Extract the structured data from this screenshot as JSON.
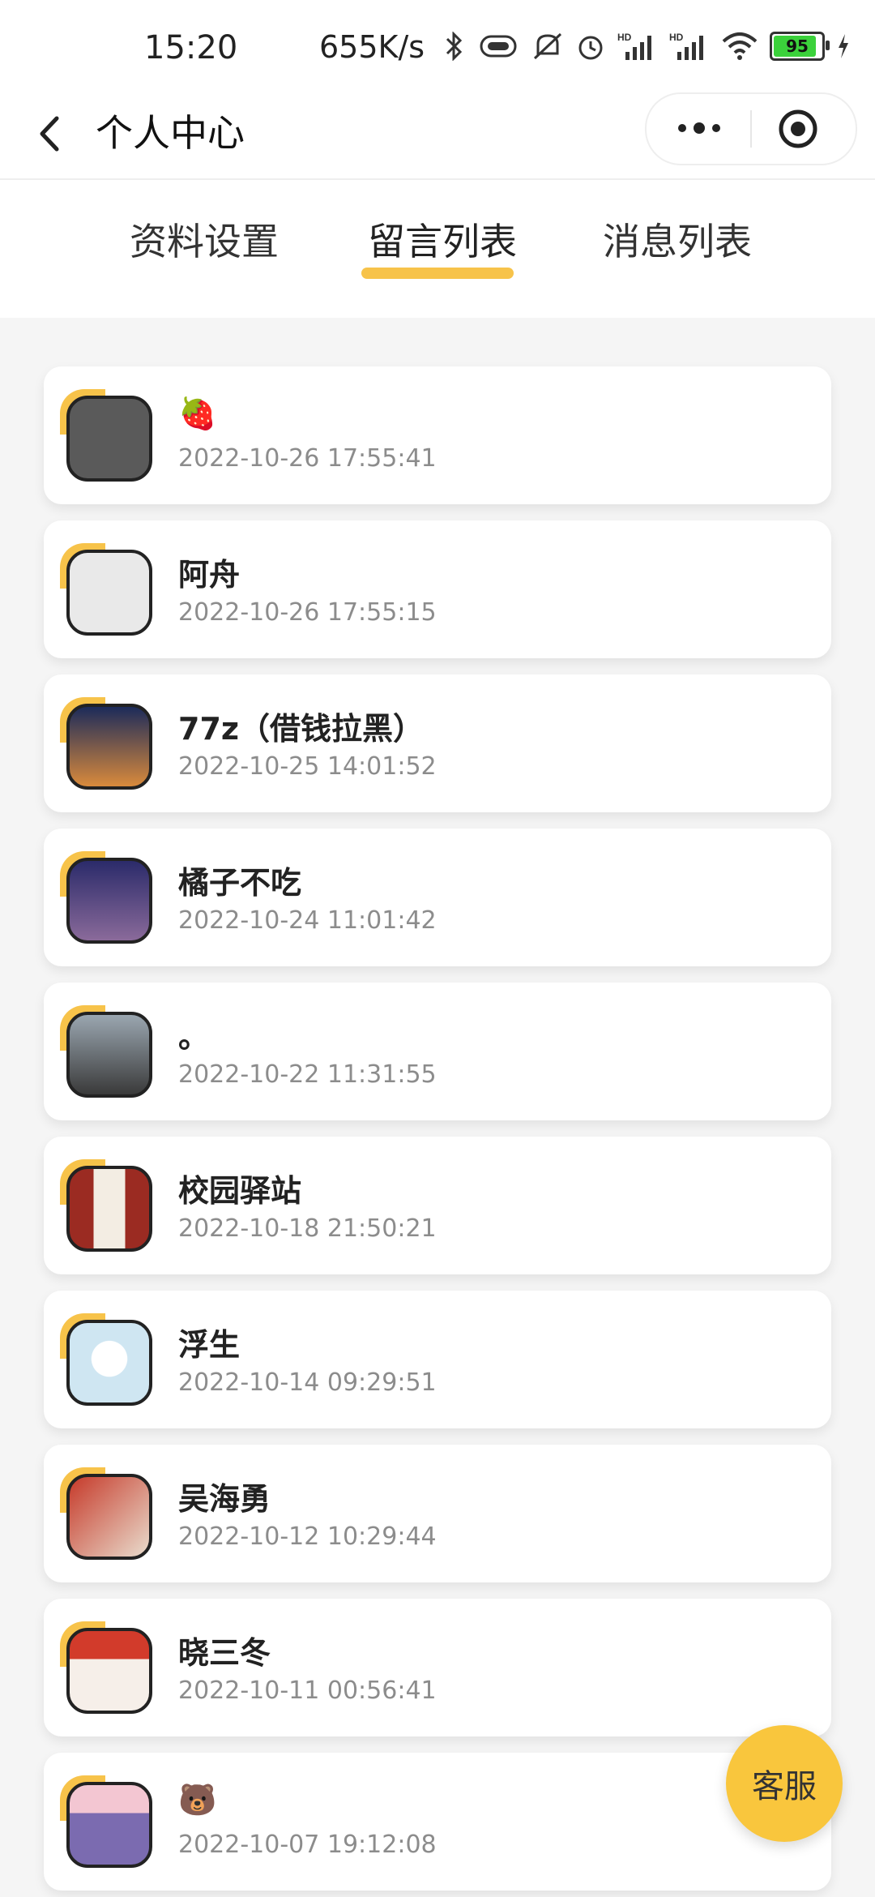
{
  "status_bar": {
    "time": "15:20",
    "speed": "655K/s",
    "battery": "95"
  },
  "nav": {
    "title": "个人中心"
  },
  "tabs": [
    {
      "label": "资料设置"
    },
    {
      "label": "留言列表"
    },
    {
      "label": "消息列表"
    }
  ],
  "active_tab": 1,
  "messages": [
    {
      "name": "🍓",
      "time": "2022-10-26 17:55:41",
      "avatar_color": "#5a5a5a"
    },
    {
      "name": "阿舟",
      "time": "2022-10-26 17:55:15",
      "avatar_color": "#e9e9e9"
    },
    {
      "name": "77z（借钱拉黑）",
      "time": "2022-10-25 14:01:52",
      "avatar_color": "#3b5a8a"
    },
    {
      "name": "橘子不吃",
      "time": "2022-10-24 11:01:42",
      "avatar_color": "#4b3b7a"
    },
    {
      "name": "。",
      "time": "2022-10-22 11:31:55",
      "avatar_color": "#6b6b6b"
    },
    {
      "name": "校园驿站",
      "time": "2022-10-18 21:50:21",
      "avatar_color": "#9b2b22"
    },
    {
      "name": "浮生",
      "time": "2022-10-14 09:29:51",
      "avatar_color": "#cfe6f2"
    },
    {
      "name": "吴海勇",
      "time": "2022-10-12 10:29:44",
      "avatar_color": "#c63a2a"
    },
    {
      "name": "晓三冬",
      "time": "2022-10-11 00:56:41",
      "avatar_color": "#f1e6e6"
    },
    {
      "name": "🐻",
      "time": "2022-10-07 19:12:08",
      "avatar_color": "#7b6bb0"
    }
  ],
  "service_button": {
    "label": "客服"
  },
  "colors": {
    "accent": "#f7c34a",
    "service": "#f9c63d"
  }
}
